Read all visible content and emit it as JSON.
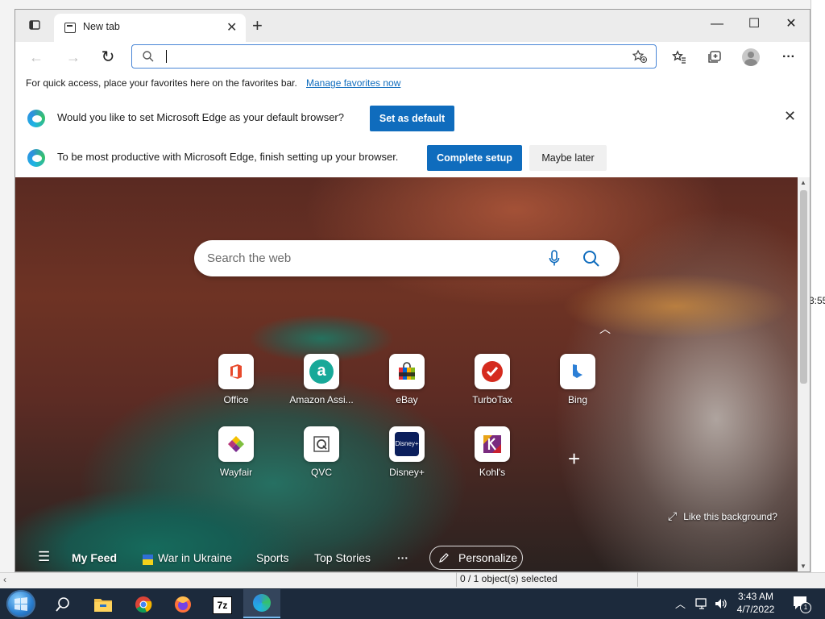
{
  "browser": {
    "tab": {
      "title": "New tab"
    },
    "window_controls": {
      "minimize": "—",
      "maximize": "☐",
      "close": "✕",
      "new_tab": "+"
    },
    "nav": {
      "back": "←",
      "forward": "→",
      "refresh": "↻",
      "more": "···"
    },
    "address_bar": {
      "value": "",
      "placeholder": ""
    },
    "favorites_bar": {
      "text": "For quick access, place your favorites here on the favorites bar.",
      "link": "Manage favorites now"
    },
    "infobars": [
      {
        "text": "Would you like to set Microsoft Edge as your default browser?",
        "primary": "Set as default",
        "close": "✕"
      },
      {
        "text": "To be most productive with Microsoft Edge, finish setting up your browser.",
        "primary": "Complete setup",
        "secondary": "Maybe later"
      }
    ]
  },
  "ntp": {
    "search_placeholder": "Search the web",
    "collapse": "︿",
    "tiles": [
      {
        "label": "Office",
        "icon": "office-icon"
      },
      {
        "label": "Amazon Assi...",
        "icon": "amazon-assistant-icon"
      },
      {
        "label": "eBay",
        "icon": "ebay-icon"
      },
      {
        "label": "TurboTax",
        "icon": "turbotax-icon"
      },
      {
        "label": "Bing",
        "icon": "bing-icon"
      },
      {
        "label": "Wayfair",
        "icon": "wayfair-icon"
      },
      {
        "label": "QVC",
        "icon": "qvc-icon"
      },
      {
        "label": "Disney+",
        "icon": "disney-plus-icon"
      },
      {
        "label": "Kohl's",
        "icon": "kohls-icon"
      }
    ],
    "add_tile": "+",
    "like_background": "Like this background?",
    "feed": {
      "menu": "☰",
      "items": [
        "My Feed",
        "War in Ukraine",
        "Sports",
        "Top Stories"
      ],
      "more": "···",
      "personalize": "Personalize"
    }
  },
  "background_app": {
    "status": "0 / 1 object(s) selected",
    "time_fragment": "3:55"
  },
  "taskbar": {
    "apps": [
      "start",
      "search",
      "file-explorer",
      "chrome",
      "firefox",
      "7zip",
      "edge"
    ],
    "sevenzip_label": "7z",
    "clock_time": "3:43 AM",
    "clock_date": "4/7/2022",
    "notification_count": "1"
  },
  "colors": {
    "accent": "#0f6cbd",
    "taskbar": "#1c2a3c"
  }
}
